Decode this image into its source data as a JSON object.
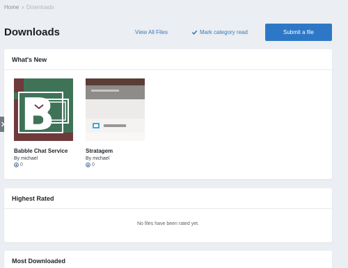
{
  "breadcrumb": {
    "home": "Home",
    "separator": "›",
    "current": "Downloads"
  },
  "page": {
    "title": "Downloads"
  },
  "actions": {
    "view_all": "View All Files",
    "mark_read": "Mark category read",
    "submit": "Submit a file"
  },
  "whats_new": {
    "title": "What's New",
    "files": [
      {
        "title": "Babble Chat Service",
        "author": "By michael",
        "count": "0"
      },
      {
        "title": "Stratagem",
        "author": "By michael",
        "count": "0"
      }
    ]
  },
  "highest_rated": {
    "title": "Highest Rated",
    "empty": "No files have been rated yet."
  },
  "most_downloaded": {
    "title": "Most Downloaded"
  },
  "colors": {
    "accent": "#2d78c6",
    "link": "#3a7ab8",
    "background": "#ebeef2"
  },
  "icons": {
    "check": "check-icon",
    "chevron": "chevron-right-icon",
    "stat": "download-count-icon"
  }
}
